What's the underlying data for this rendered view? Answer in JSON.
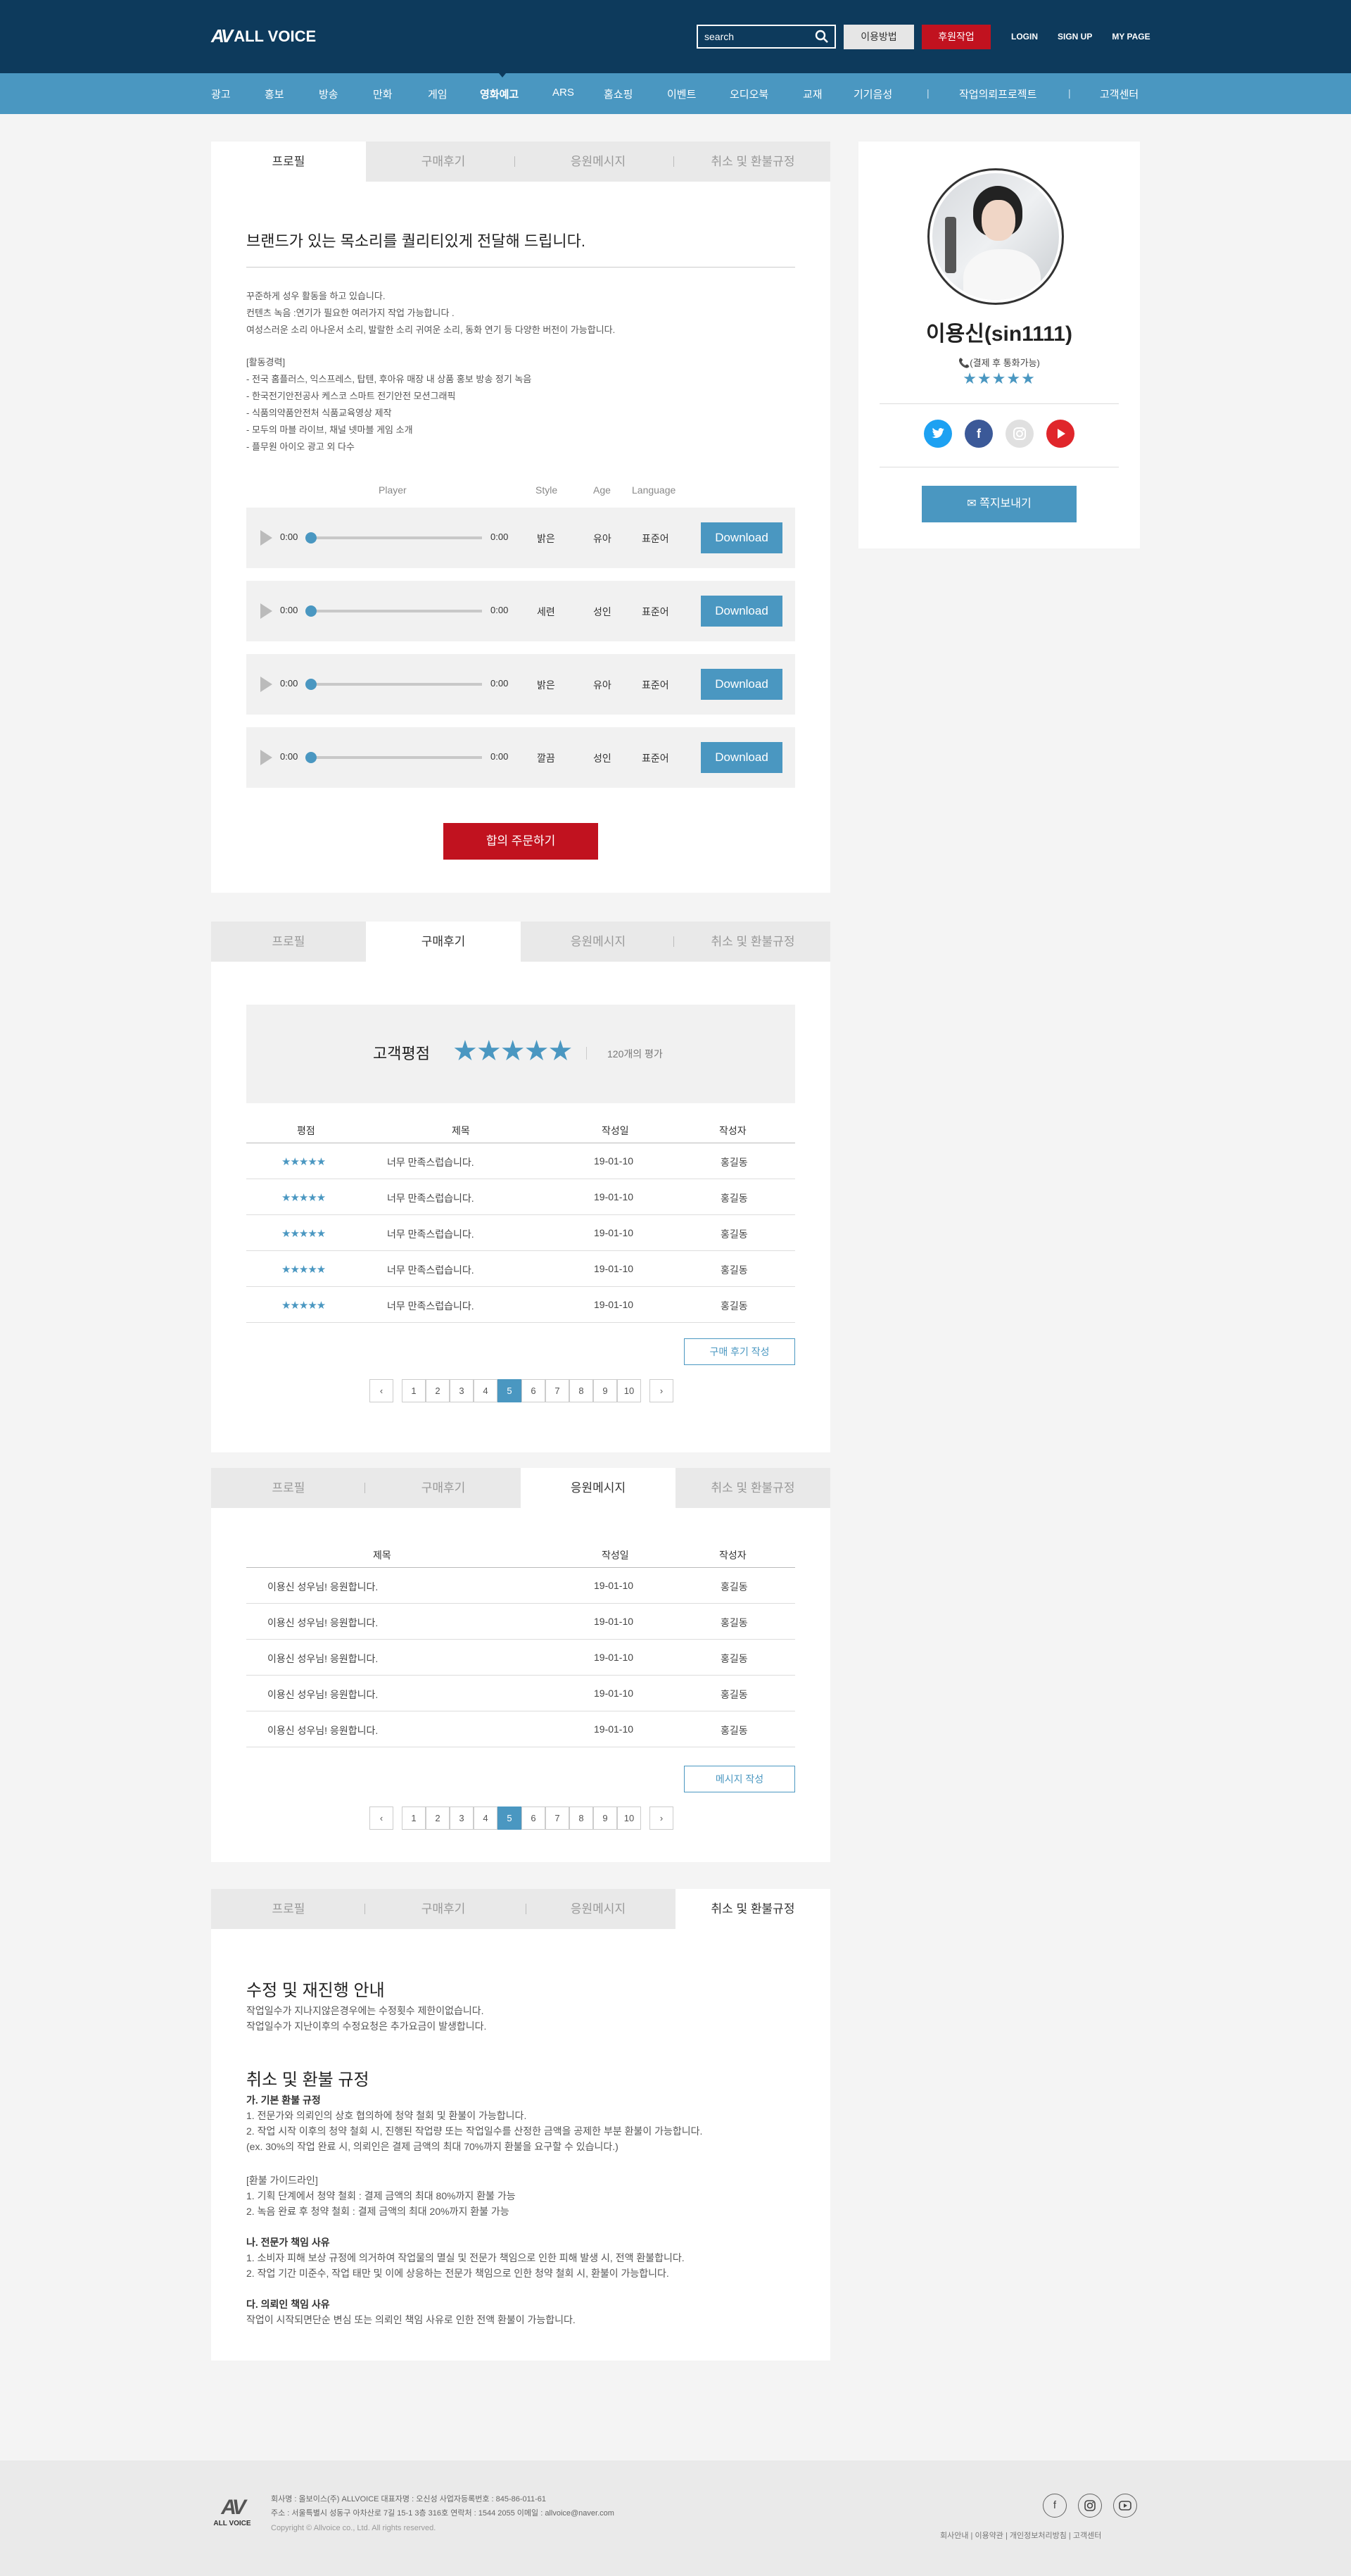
{
  "header": {
    "logo_mark": "AV",
    "logo_text": "ALL VOICE",
    "search_placeholder": "search",
    "how_to": "이용방법",
    "sponsor": "후원작업",
    "links": [
      "LOGIN",
      "SIGN UP",
      "MY PAGE"
    ]
  },
  "gnb": [
    "광고",
    "홍보",
    "방송",
    "만화",
    "게임",
    "영화예고",
    "ARS",
    "홈쇼핑",
    "이벤트",
    "오디오북",
    "교재",
    "기기음성",
    "작업의뢰프로젝트",
    "고객센터"
  ],
  "tabs": [
    "프로필",
    "구매후기",
    "응원메시지",
    "취소 및 환불규정"
  ],
  "side": {
    "name": "이용신(sin1111)",
    "pay_note": "📞(결제 후 통화가능)",
    "stars": "★★★★★",
    "socials": [
      "twitter",
      "facebook",
      "instagram",
      "youtube"
    ],
    "message_button": "✉ 쪽지보내기"
  },
  "profile": {
    "headline": "브랜드가 있는 목소리를 퀄리티있게 전달해 드립니다.",
    "intro": "꾸준하게 성우 활동을 하고 있습니다.\n컨텐츠 녹음 :연기가 필요한 여러가지 작업 가능합니다 .\n여성스러운 소리 아나운서 소리, 발랄한 소리 귀여운 소리, 동화 연기 등 다양한 버전이 가능합니다.",
    "career": "[활동경력]\n- 전국 홈플러스, 익스프레스, 탑텐, 후아유 매장 내 상품 홍보 방송 정기 녹음\n- 한국전기안전공사 케스코 스마트 전기안전 모션그래픽\n- 식품의약품안전처 식품교육영상 제작\n- 모두의 마블 라이브, 채널 넷마블 게임 소개\n- 플무원 아이오 광고 외 다수",
    "columns": [
      "Player",
      "Style",
      "Age",
      "Language"
    ],
    "samples": [
      {
        "time_start": "0:00",
        "time_end": "0:00",
        "progress": 0,
        "style": "밝은",
        "age": "유아",
        "language": "표준어",
        "download": "Download"
      },
      {
        "time_start": "0:00",
        "time_end": "0:00",
        "progress": 0,
        "style": "세련",
        "age": "성인",
        "language": "표준어",
        "download": "Download"
      },
      {
        "time_start": "0:00",
        "time_end": "0:00",
        "progress": 0,
        "style": "밝은",
        "age": "유아",
        "language": "표준어",
        "download": "Download"
      },
      {
        "time_start": "0:00",
        "time_end": "0:00",
        "progress": 0,
        "style": "깔끔",
        "age": "성인",
        "language": "표준어",
        "download": "Download"
      }
    ],
    "order_button": "합의 주문하기"
  },
  "reviews": {
    "rating_label": "고객평점",
    "rating_stars": "★★★★★",
    "count": "120개의 평가",
    "columns": [
      "평점",
      "제목",
      "작성일",
      "작성자"
    ],
    "rows": [
      {
        "stars": "★★★★★",
        "title": "너무 만족스럽습니다.",
        "date": "19-01-10",
        "author": "홍길동"
      },
      {
        "stars": "★★★★★",
        "title": "너무 만족스럽습니다.",
        "date": "19-01-10",
        "author": "홍길동"
      },
      {
        "stars": "★★★★★",
        "title": "너무 만족스럽습니다.",
        "date": "19-01-10",
        "author": "홍길동"
      },
      {
        "stars": "★★★★★",
        "title": "너무 만족스럽습니다.",
        "date": "19-01-10",
        "author": "홍길동"
      },
      {
        "stars": "★★★★★",
        "title": "너무 만족스럽습니다.",
        "date": "19-01-10",
        "author": "홍길동"
      }
    ],
    "write_button": "구매 후기 작성"
  },
  "cheers": {
    "columns": [
      "제목",
      "작성일",
      "작성자"
    ],
    "rows": [
      {
        "title": "이용신 성우님! 응원합니다.",
        "date": "19-01-10",
        "author": "홍길동"
      },
      {
        "title": "이용신 성우님! 응원합니다.",
        "date": "19-01-10",
        "author": "홍길동"
      },
      {
        "title": "이용신 성우님! 응원합니다.",
        "date": "19-01-10",
        "author": "홍길동"
      },
      {
        "title": "이용신 성우님! 응원합니다.",
        "date": "19-01-10",
        "author": "홍길동"
      },
      {
        "title": "이용신 성우님! 응원합니다.",
        "date": "19-01-10",
        "author": "홍길동"
      }
    ],
    "write_button": "메시지 작성"
  },
  "pagination": {
    "prev": "‹",
    "next": "›",
    "pages": [
      "1",
      "2",
      "3",
      "4",
      "5",
      "6",
      "7",
      "8",
      "9",
      "10"
    ],
    "current": "5"
  },
  "refund": {
    "title1": "수정 및 재진행 안내",
    "text1": "작업일수가 지나지않은경우에는 수정횟수 제한이없습니다.\n작업일수가 지난이후의 수정요청은 추가요금이 발생합니다.",
    "title2": "취소 및 환불 규정",
    "a_title": "가. 기본 환불 규정",
    "a_text": "1. 전문가와 의뢰인의 상호 협의하에 청약 철회 및 환불이 가능합니다.\n2. 작업 시작 이후의 청약 철회 시, 진행된 작업량 또는 작업일수를 산정한 금액을 공제한 부분 환불이 가능합니다.\n(ex. 30%의 작업 완료 시, 의뢰인은 결제 금액의 최대 70%까지 환불을 요구할 수 있습니다.)",
    "guide": "[환불 가이드라인]\n1. 기획 단계에서 청약 철회 : 결제 금액의 최대 80%까지 환불 가능\n2. 녹음 완료 후 청약 철회 : 결제 금액의 최대 20%까지 환불 가능",
    "b_title": "나. 전문가 책임 사유",
    "b_text": "1. 소비자 피해 보상 규정에 의거하여 작업물의 멸실 및 전문가 책임으로 인한 피해 발생 시, 전액 환불합니다.\n2. 작업 기간 미준수, 작업 태만 및 이에 상응하는 전문가 책임으로 인한 청약 철회 시, 환불이 가능합니다.",
    "c_title": "다. 의뢰인 책임 사유",
    "c_text": "작업이 시작되면단순 변심 또는 의뢰인 책임 사유로 인한 전액 환불이 가능합니다."
  },
  "footer": {
    "logo_mark": "AV",
    "logo_text": "ALL VOICE",
    "info": "회사명 : 올보이스(주) ALLVOICE 대표자명 : 오신성 사업자등록번호 : 845-86-011-61\n주소 : 서울특별시 성동구 아차산로 7길 15-1 3층 316호 연락처 : 1544 2055 이메일 : allvoice@naver.com",
    "copyright": "Copyright © Allvoice co., Ltd. All rights reserved.",
    "links": "회사안내  |  이용약관  |  개인정보처리방침  |  고객센터"
  }
}
